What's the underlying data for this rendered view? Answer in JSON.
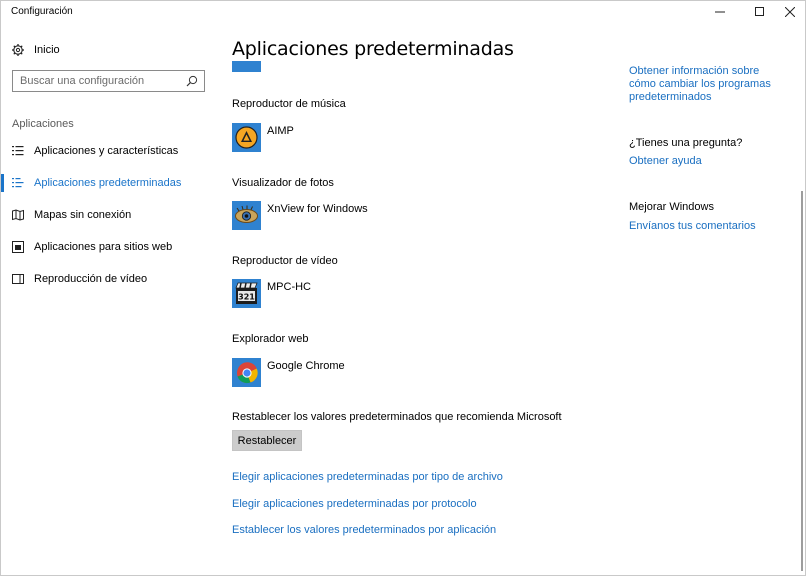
{
  "window": {
    "title": "Configuración",
    "controls": [
      "minimize-icon",
      "maximize-icon",
      "close-icon"
    ]
  },
  "sidebar": {
    "home_label": "Inicio",
    "search_placeholder": "Buscar una configuración",
    "section_label": "Aplicaciones",
    "items": [
      {
        "label": "Aplicaciones y características",
        "icon": "list-icon",
        "active": false
      },
      {
        "label": "Aplicaciones predeterminadas",
        "icon": "default-apps-icon",
        "active": true
      },
      {
        "label": "Mapas sin conexión",
        "icon": "map-icon",
        "active": false
      },
      {
        "label": "Aplicaciones para sitios web",
        "icon": "web-app-icon",
        "active": false
      },
      {
        "label": "Reproducción de vídeo",
        "icon": "video-icon",
        "active": false
      }
    ]
  },
  "main": {
    "title": "Aplicaciones predeterminadas",
    "categories": [
      {
        "label": "Reproductor de música",
        "app": "AIMP",
        "icon": "aimp-icon"
      },
      {
        "label": "Visualizador de fotos",
        "app": "XnView for Windows",
        "icon": "xnview-icon"
      },
      {
        "label": "Reproductor de vídeo",
        "app": "MPC-HC",
        "icon": "mpc-hc-icon"
      },
      {
        "label": "Explorador web",
        "app": "Google Chrome",
        "icon": "chrome-icon"
      }
    ],
    "reset_label": "Restablecer los valores predeterminados que recomienda Microsoft",
    "reset_button": "Restablecer",
    "links": [
      "Elegir aplicaciones predeterminadas por tipo de archivo",
      "Elegir aplicaciones predeterminadas por protocolo",
      "Establecer los valores predeterminados por aplicación"
    ]
  },
  "related": {
    "info_link": "Obtener información sobre cómo cambiar los programas predeterminados",
    "question_heading": "¿Tienes una pregunta?",
    "help_link": "Obtener ayuda",
    "improve_heading": "Mejorar Windows",
    "feedback_link": "Envíanos tus comentarios"
  },
  "colors": {
    "accent": "#1a74c9",
    "link": "#1a6fc1",
    "tile": "#2f82d0",
    "button": "#cccccc"
  }
}
